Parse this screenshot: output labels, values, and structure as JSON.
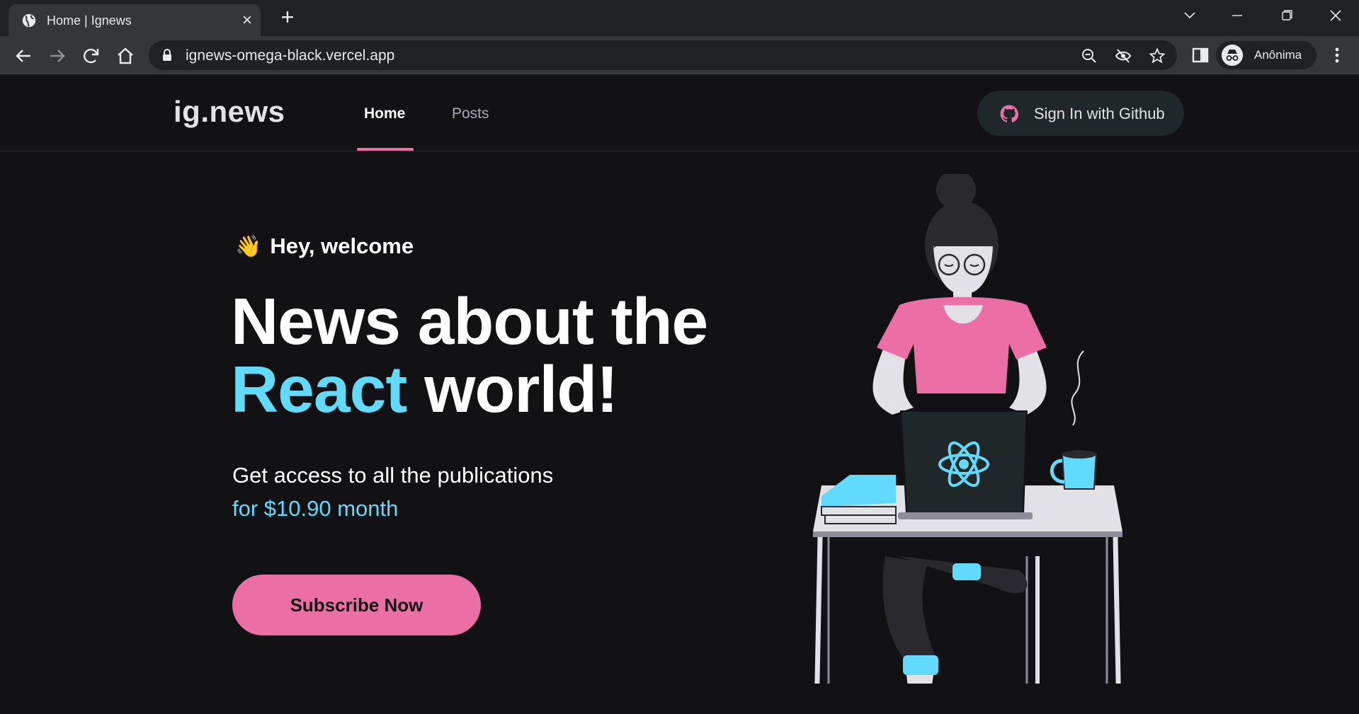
{
  "browser": {
    "tab_title": "Home | Ignews",
    "new_tab": "+",
    "close_tab": "×",
    "url": "ignews-omega-black.vercel.app",
    "profile_label": "Anônima"
  },
  "site": {
    "logo": "ig.news",
    "nav": [
      {
        "label": "Home",
        "active": true
      },
      {
        "label": "Posts",
        "active": false
      }
    ],
    "sign_in_label": "Sign In with Github"
  },
  "hero": {
    "greeting_icon": "👋",
    "greeting": "Hey, welcome",
    "headline_line1": "News about the",
    "headline_accent": "React",
    "headline_rest": " world!",
    "access_text": "Get access to all the publications",
    "price_text": "for $10.90 month",
    "cta_label": "Subscribe Now"
  },
  "colors": {
    "background": "#121214",
    "accent_pink": "#eb6fa5",
    "accent_cyan": "#61dafb"
  }
}
